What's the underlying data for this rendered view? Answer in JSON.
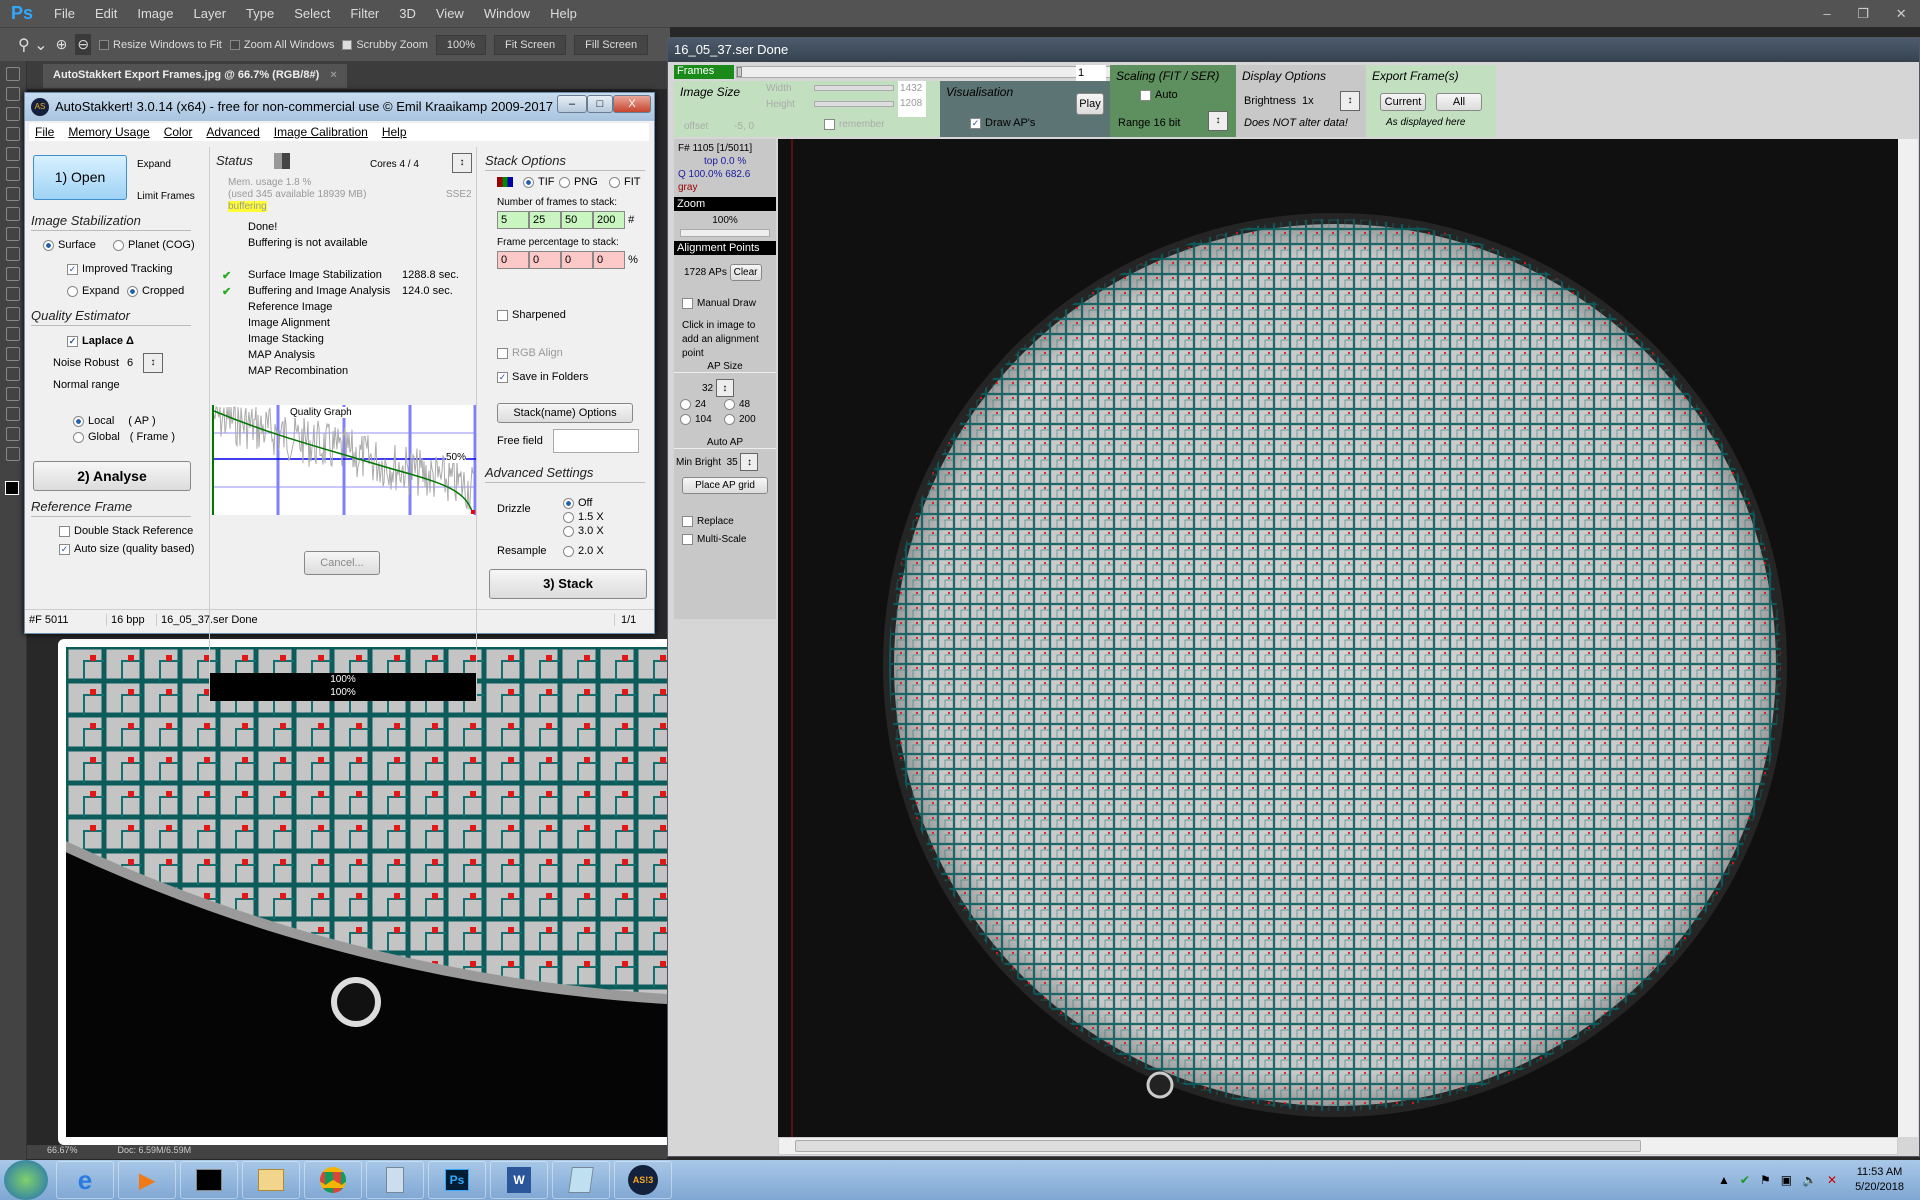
{
  "ps": {
    "logo": "Ps",
    "menu": [
      "File",
      "Edit",
      "Image",
      "Layer",
      "Type",
      "Select",
      "Filter",
      "3D",
      "View",
      "Window",
      "Help"
    ],
    "options": {
      "resize": "Resize Windows to Fit",
      "zoom_all": "Zoom All Windows",
      "scrubby": "Scrubby Zoom",
      "zoom_value": "100%",
      "fit": "Fit Screen",
      "fill": "Fill Screen"
    },
    "doc_tab": "AutoStakkert Export Frames.jpg @ 66.7% (RGB/8#)",
    "doc_close": "×",
    "status_zoom": "66.67%",
    "status_doc": "Doc: 6.59M/6.59M"
  },
  "as": {
    "title": "AutoStakkert! 3.0.14 (x64) - free for non-commercial use © Emil Kraaikamp 2009-2017",
    "menu": [
      "File",
      "Memory Usage",
      "Color",
      "Advanced",
      "Image Calibration",
      "Help"
    ],
    "open": "1) Open",
    "expand": "Expand",
    "limit_frames": "Limit Frames",
    "image_stab": "Image Stabilization",
    "surface": "Surface",
    "planet": "Planet (COG)",
    "improved_tracking": "Improved Tracking",
    "expand2": "Expand",
    "cropped": "Cropped",
    "quality_est": "Quality Estimator",
    "laplace": "Laplace Δ",
    "noise_robust": "Noise Robust",
    "noise_value": "6",
    "normal_range": "Normal range",
    "local": "Local",
    "local_ap": "( AP )",
    "global": "Global",
    "global_frame": "( Frame )",
    "analyse": "2) Analyse",
    "ref_frame": "Reference Frame",
    "double_stack": "Double Stack Reference",
    "auto_size": "Auto size (quality based)",
    "status": "Status",
    "cores": "Cores 4 / 4",
    "mem1": "Mem. usage 1.8 %",
    "mem2": "(used 345 available 18939 MB)",
    "sse": "SSE2",
    "buffering": "buffering",
    "done": "Done!",
    "buf_na": "Buffering is not available",
    "steps": [
      {
        "label": "Surface Image Stabilization",
        "time": "1288.8 sec.",
        "done": true
      },
      {
        "label": "Buffering and Image Analysis",
        "time": "124.0 sec.",
        "done": true
      },
      {
        "label": "Reference Image",
        "time": "",
        "done": false
      },
      {
        "label": "Image Alignment",
        "time": "",
        "done": false
      },
      {
        "label": "Image Stacking",
        "time": "",
        "done": false
      },
      {
        "label": "MAP Analysis",
        "time": "",
        "done": false
      },
      {
        "label": "MAP Recombination",
        "time": "",
        "done": false
      }
    ],
    "quality_graph": "Quality Graph",
    "graph_pct": "50%",
    "cancel": "Cancel...",
    "progress1": "100%",
    "progress2": "100%",
    "stack_options": "Stack Options",
    "tif": "TIF",
    "png": "PNG",
    "fit": "FIT",
    "num_frames_label": "Number of frames to stack:",
    "num_frames": [
      "5",
      "25",
      "50",
      "200"
    ],
    "hash": "#",
    "pct_label": "Frame percentage to stack:",
    "pct": [
      "0",
      "0",
      "0",
      "0"
    ],
    "pct_sign": "%",
    "sharpened": "Sharpened",
    "rgb_align": "RGB Align",
    "save_folders": "Save in Folders",
    "stack_name": "Stack(name) Options",
    "free_field": "Free field",
    "free_value": "",
    "advanced": "Advanced Settings",
    "drizzle": "Drizzle",
    "d_off": "Off",
    "d_15": "1.5 X",
    "d_30": "3.0 X",
    "resample": "Resample",
    "r_20": "2.0 X",
    "stack": "3) Stack",
    "sb_frames": "#F 5011",
    "sb_bpp": "16 bpp",
    "sb_file": "16_05_37.ser  Done",
    "sb_page": "1/1"
  },
  "view": {
    "title": "16_05_37.ser  Done",
    "frames": "Frames",
    "frame_value": "1",
    "image_size": "Image Size",
    "width": "Width",
    "height": "Height",
    "width_v": "1432",
    "height_v": "1208",
    "offset": "offset",
    "offset_v": "-5, 0",
    "remember": "remember",
    "visualisation": "Visualisation",
    "draw_aps": "Draw AP's",
    "play": "Play",
    "scaling": "Scaling (FIT / SER)",
    "auto": "Auto",
    "range": "Range 16 bit",
    "display": "Display Options",
    "brightness": "Brightness",
    "brightness_v": "1x",
    "not_alter": "Does NOT alter data!",
    "export": "Export Frame(s)",
    "current": "Current",
    "all": "All",
    "as_displayed": "As displayed here",
    "fnum": "F# 1105 [1/5011]",
    "top": "top 0.0 %",
    "q": "Q 100.0%  682.6",
    "gray": "gray",
    "zoom": "Zoom",
    "zoom_v": "100%",
    "ap_head": "Alignment Points",
    "ap_count": "1728 APs",
    "clear": "Clear",
    "manual_draw": "Manual Draw",
    "click_hint": "Click in image to add an alignment point",
    "ap_size": "AP Size",
    "ap_size_v": "32",
    "sizes": [
      "24",
      "48",
      "104",
      "200"
    ],
    "auto_ap": "Auto AP",
    "min_bright": "Min Bright",
    "min_bright_v": "35",
    "place_grid": "Place AP grid",
    "replace": "Replace",
    "multi_scale": "Multi-Scale"
  },
  "taskbar": {
    "apps": [
      "start",
      "ie",
      "media",
      "cmd",
      "explorer",
      "chrome",
      "calculator",
      "photoshop",
      "word",
      "notepad",
      "autostakkert"
    ],
    "ps_label": "Ps",
    "as_label": "AS!3",
    "time": "11:53 AM",
    "date": "5/20/2018"
  },
  "colors": {
    "ap_grid": "#0d5c5c",
    "ap_marker": "#e01818",
    "green_panel": "#c2e0c0",
    "frames_green": "#1a8a1a"
  }
}
